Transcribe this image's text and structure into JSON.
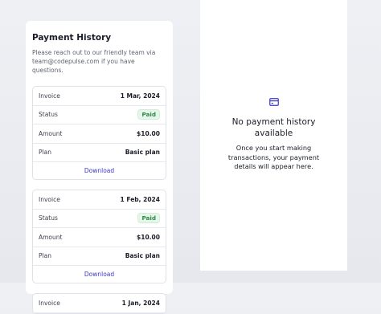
{
  "payment_history": {
    "title": "Payment History",
    "description": "Please reach out to our friendly team via team@codepulse.com if you have questions.",
    "invoices": [
      {
        "invoice_label": "Invoice",
        "invoice_date": "1 Mar, 2024",
        "status_label": "Status",
        "status": "Paid",
        "amount_label": "Amount",
        "amount": "$10.00",
        "plan_label": "Plan",
        "plan": "Basic plan",
        "download_label": "Download"
      },
      {
        "invoice_label": "Invoice",
        "invoice_date": "1 Feb, 2024",
        "status_label": "Status",
        "status": "Paid",
        "amount_label": "Amount",
        "amount": "$10.00",
        "plan_label": "Plan",
        "plan": "Basic plan",
        "download_label": "Download"
      },
      {
        "invoice_label": "Invoice",
        "invoice_date": "1 Jan, 2024"
      }
    ]
  },
  "empty_state": {
    "icon": "credit-card-icon",
    "title": "No payment history available",
    "description": "Once you start making transactions, your payment details will appear here."
  },
  "colors": {
    "accent": "#3b37c8",
    "paid_badge_bg": "#e6f6ea",
    "paid_badge_text": "#2f8a46"
  }
}
